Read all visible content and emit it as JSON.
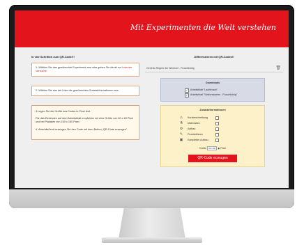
{
  "header": {
    "title": "Mit Experimenten die Welt verstehen"
  },
  "left": {
    "title": "In vier Schritten zum QR-Code!!!",
    "step1_text": "1. Wählen Sie das gewünschte Experiment aus oder geben Sie direkt zur ",
    "step1_link": "Liste der Versuche.",
    "step2": "2. Wählen Sie aus der Liste die gewünschten Zusatzinformationen aus.",
    "step3": "3.Legen Sie die Größe des Codes in Pixel fest.",
    "step3b": "Für das Einbinden auf dem Arbeitsblatt empfehlen wir eine Größe von 60 x 60 Pixel und bei Plakaten von 150 x 150 Pixel.",
    "step4": "4. Abschließend erzeugen Sie den Code mit dem Button „QR-Code erzeugen\"."
  },
  "right": {
    "title": "Differenzieren mit QR-Codes!!",
    "selected_experiment": "Genetic-Regeln der Wechsel - Froschkönig",
    "downloads": {
      "title": "Downloads",
      "items": [
        "Arbeitsblatt \"Laubfrosch\"",
        "Arbeitsblatt \"Stationskarten - Froschkönig\""
      ]
    },
    "zusatz": {
      "title": "Zusatzinformationen",
      "items": [
        {
          "icon": "⚠",
          "label": "Kurzbeschreibung"
        },
        {
          "icon": "⚗",
          "label": "Materialien"
        },
        {
          "icon": "⚙",
          "label": "Aufbau"
        },
        {
          "icon": "✎",
          "label": "Protokollieren"
        },
        {
          "icon": "▣",
          "label": "Kompletter Aufbau"
        }
      ],
      "size_label": "Größe",
      "size_value": "60 x 60",
      "unit_label": "Pixel"
    },
    "button_label": "QR-Code erzeugen"
  }
}
